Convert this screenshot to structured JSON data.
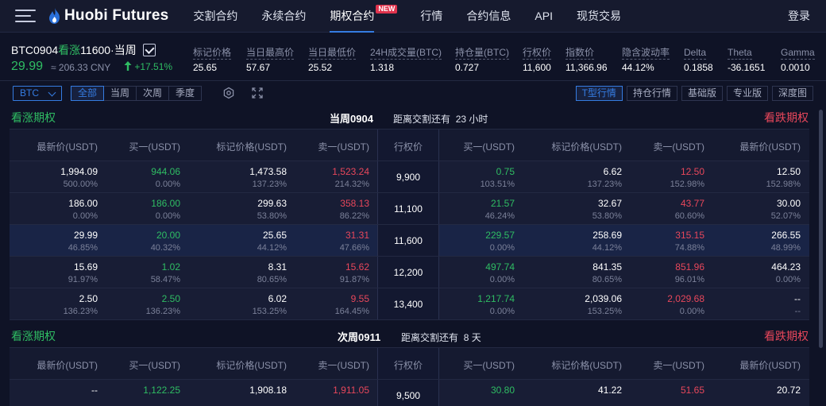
{
  "nav": {
    "logo_prefix": "Huobi",
    "logo_suffix": "Futures",
    "links": [
      "交割合约",
      "永续合约",
      "期权合约",
      "行情",
      "合约信息",
      "API",
      "现货交易"
    ],
    "active_index": 2,
    "new_badge": "NEW",
    "login": "登录"
  },
  "ticker": {
    "symbol_a": "BTC0904",
    "symbol_call": "看涨",
    "symbol_b": "11600·当周",
    "last_price": "29.99",
    "cny": "≈ 206.33 CNY",
    "change": "+17.51%",
    "stats": [
      {
        "label": "标记价格",
        "value": "25.65"
      },
      {
        "label": "当日最高价",
        "value": "57.67"
      },
      {
        "label": "当日最低价",
        "value": "25.52"
      },
      {
        "label": "24H成交量(BTC)",
        "value": "1.318"
      },
      {
        "label": "持仓量(BTC)",
        "value": "0.727"
      },
      {
        "label": "行权价",
        "value": "11,600"
      },
      {
        "label": "指数价",
        "value": "11,366.96"
      },
      {
        "label": "隐含波动率",
        "value": "44.12%"
      },
      {
        "label": "Delta",
        "value": "0.1858"
      },
      {
        "label": "Theta",
        "value": "-36.1651"
      },
      {
        "label": "Gamma",
        "value": "0.0010"
      }
    ]
  },
  "toolbar": {
    "currency": "BTC",
    "filters": [
      "全部",
      "当周",
      "次周",
      "季度"
    ],
    "views": [
      "T型行情",
      "持仓行情",
      "基础版",
      "专业版",
      "深度图"
    ]
  },
  "columns": {
    "call": [
      "最新价(USDT)",
      "买一(USDT)",
      "标记价格(USDT)",
      "卖一(USDT)"
    ],
    "strike": "行权价",
    "put": [
      "买一(USDT)",
      "标记价格(USDT)",
      "卖一(USDT)",
      "最新价(USDT)"
    ]
  },
  "sections": [
    {
      "calls_label": "看涨期权",
      "puts_label": "看跌期权",
      "expiry": "当周0904",
      "countdown_label": "距离交割还有",
      "countdown": "23 小时",
      "rows": [
        {
          "strike": "9,900",
          "c": [
            [
              "1,994.09",
              "500.00%"
            ],
            [
              "944.06",
              "0.00%"
            ],
            [
              "1,473.58",
              "137.23%"
            ],
            [
              "1,523.24",
              "214.32%"
            ]
          ],
          "p": [
            [
              "0.75",
              "103.51%"
            ],
            [
              "6.62",
              "137.23%"
            ],
            [
              "12.50",
              "152.98%"
            ],
            [
              "12.50",
              "152.98%"
            ]
          ]
        },
        {
          "strike": "11,100",
          "c": [
            [
              "186.00",
              "0.00%"
            ],
            [
              "186.00",
              "0.00%"
            ],
            [
              "299.63",
              "53.80%"
            ],
            [
              "358.13",
              "86.22%"
            ]
          ],
          "p": [
            [
              "21.57",
              "46.24%"
            ],
            [
              "32.67",
              "53.80%"
            ],
            [
              "43.77",
              "60.60%"
            ],
            [
              "30.00",
              "52.07%"
            ]
          ]
        },
        {
          "strike": "11,600",
          "c": [
            [
              "29.99",
              "46.85%"
            ],
            [
              "20.00",
              "40.32%"
            ],
            [
              "25.65",
              "44.12%"
            ],
            [
              "31.31",
              "47.66%"
            ]
          ],
          "p": [
            [
              "229.57",
              "0.00%"
            ],
            [
              "258.69",
              "44.12%"
            ],
            [
              "315.15",
              "74.88%"
            ],
            [
              "266.55",
              "48.99%"
            ]
          ]
        },
        {
          "strike": "12,200",
          "c": [
            [
              "15.69",
              "91.97%"
            ],
            [
              "1.02",
              "58.47%"
            ],
            [
              "8.31",
              "80.65%"
            ],
            [
              "15.62",
              "91.87%"
            ]
          ],
          "p": [
            [
              "497.74",
              "0.00%"
            ],
            [
              "841.35",
              "80.65%"
            ],
            [
              "851.96",
              "96.01%"
            ],
            [
              "464.23",
              "0.00%"
            ]
          ]
        },
        {
          "strike": "13,400",
          "c": [
            [
              "2.50",
              "136.23%"
            ],
            [
              "2.50",
              "136.23%"
            ],
            [
              "6.02",
              "153.25%"
            ],
            [
              "9.55",
              "164.45%"
            ]
          ],
          "p": [
            [
              "1,217.74",
              "0.00%"
            ],
            [
              "2,039.06",
              "153.25%"
            ],
            [
              "2,029.68",
              "0.00%"
            ],
            [
              "--",
              "--"
            ]
          ]
        }
      ]
    },
    {
      "calls_label": "看涨期权",
      "puts_label": "看跌期权",
      "expiry": "次周0911",
      "countdown_label": "距离交割还有",
      "countdown": "8 天",
      "rows": [
        {
          "strike": "9,500",
          "c": [
            [
              "--",
              ""
            ],
            [
              "1,122.25",
              ""
            ],
            [
              "1,908.18",
              ""
            ],
            [
              "1,911.05",
              ""
            ]
          ],
          "p": [
            [
              "30.80",
              ""
            ],
            [
              "41.22",
              ""
            ],
            [
              "51.65",
              ""
            ],
            [
              "20.72",
              ""
            ]
          ]
        }
      ]
    }
  ]
}
